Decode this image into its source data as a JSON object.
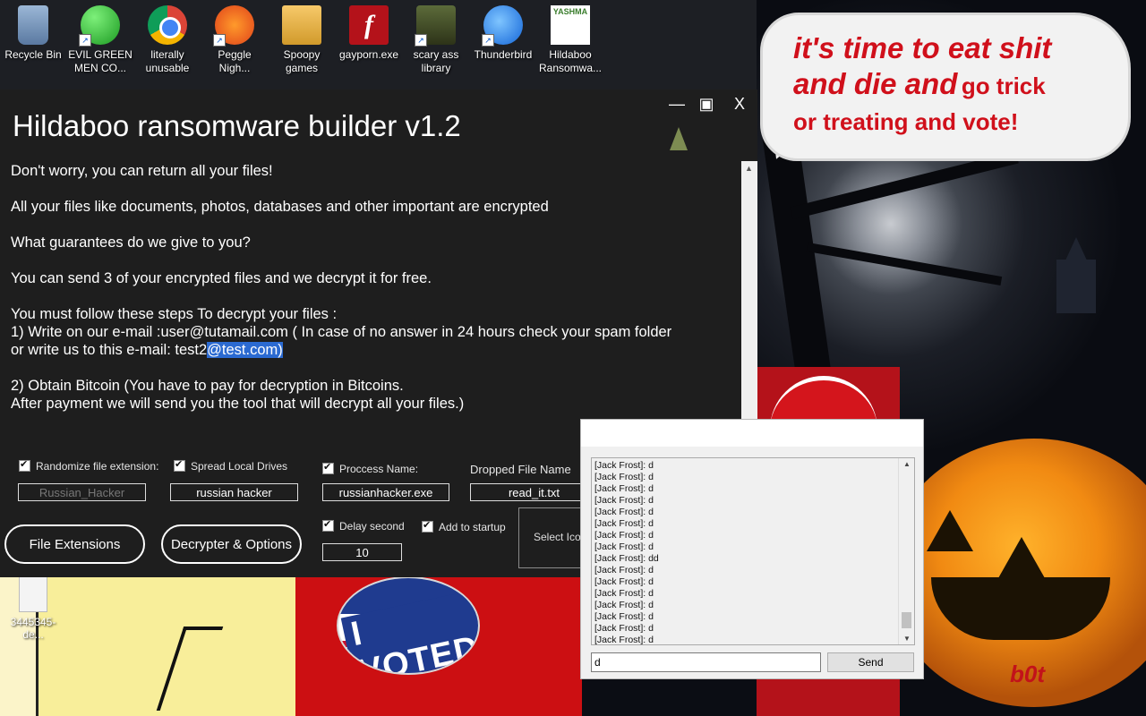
{
  "desktop": {
    "icons": [
      {
        "label": "Recycle Bin",
        "icon": "recycle-bin-icon"
      },
      {
        "label": "EVIL GREEN MEN CO...",
        "icon": "messenger-icon"
      },
      {
        "label": "literally unusable",
        "icon": "chrome-icon"
      },
      {
        "label": "Peggle Nigh...",
        "icon": "peggle-icon"
      },
      {
        "label": "Spoopy games",
        "icon": "folder-icon"
      },
      {
        "label": "gayporn.exe",
        "icon": "flash-icon"
      },
      {
        "label": "scary ass library",
        "icon": "library-icon"
      },
      {
        "label": "Thunderbird",
        "icon": "thunderbird-icon"
      },
      {
        "label": "Hildaboo Ransomwa...",
        "icon": "yashma-icon"
      }
    ],
    "icon_badge_text": "YASHMA",
    "file_label": "3445345-de...",
    "speech_line1": "it's time to eat shit",
    "speech_line2a": "and die and",
    "speech_line2b": "go trick",
    "speech_line3": "or treating and vote!",
    "badge_text": "I VOTED",
    "watermark": "b0t"
  },
  "builder": {
    "title": "Hildaboo ransomware builder v1.2",
    "min_glyph": "—",
    "max_glyph": "▣",
    "close_glyph": "X",
    "message": {
      "l1": "Don't worry, you can return all your files!",
      "l2": "All your files like documents, photos, databases and other important are encrypted",
      "l3": "What guarantees do we give to you?",
      "l4": "You can send 3 of your encrypted files and we decrypt it for free.",
      "l5": "You must follow these steps To decrypt your files :",
      "l6": "1) Write on our e-mail :user@tutamail.com ( In case of no answer in 24 hours check your spam folder",
      "l7a": "or write us to this e-mail: test2",
      "l7b": "@test.com)",
      "l8": "2) Obtain Bitcoin (You have to pay for decryption in Bitcoins.",
      "l9": "After payment we will send you the tool that will decrypt all your files.)"
    },
    "options": {
      "randomize_label": "Randomize file extension:",
      "randomize_value": "Russian_Hacker",
      "spread_label": "Spread Local Drives",
      "spread_value": "russian hacker",
      "process_label": "Proccess Name:",
      "process_value": "russianhacker.exe",
      "dropped_label": "Dropped File Name",
      "dropped_value": "read_it.txt",
      "delay_label": "Delay second",
      "delay_value": "10",
      "startup_label": "Add to startup",
      "select_icon_label": "Select Icon"
    },
    "buttons": {
      "file_extensions": "File Extensions",
      "decrypter": "Decrypter & Options"
    }
  },
  "chat": {
    "messages": [
      "[Jack Frost]: d",
      "[Jack Frost]: d",
      "[Jack Frost]: d",
      "[Jack Frost]: d",
      "[Jack Frost]: d",
      "[Jack Frost]: d",
      "[Jack Frost]: d",
      "[Jack Frost]: d",
      "[Jack Frost]: dd",
      "[Jack Frost]: d",
      "[Jack Frost]: d",
      "[Jack Frost]: d",
      "[Jack Frost]: d",
      "[Jack Frost]: d",
      "[Jack Frost]: d",
      "[Jack Frost]: d"
    ],
    "input_value": "d",
    "send_label": "Send"
  }
}
